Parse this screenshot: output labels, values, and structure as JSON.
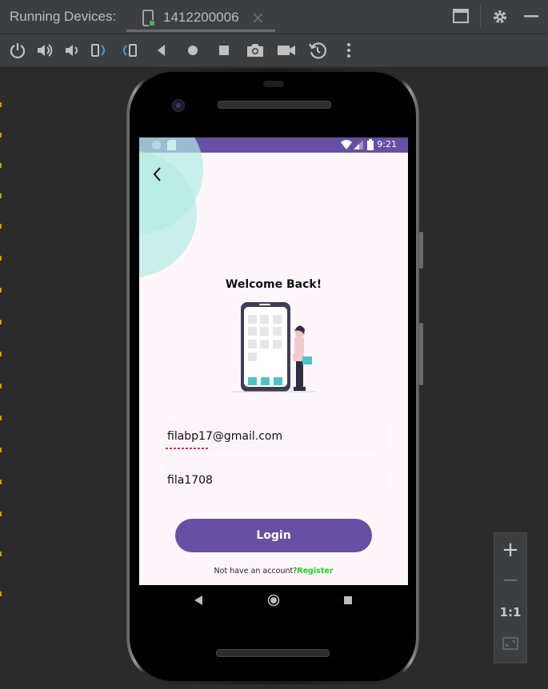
{
  "window": {
    "title": "Running Devices:",
    "tab_label": "1412200006",
    "tab_close": "×"
  },
  "toolbar": {
    "icons": [
      "power-icon",
      "volume-up-icon",
      "volume-down-icon",
      "rotate-left-icon",
      "rotate-right-icon",
      "back-icon",
      "home-icon",
      "overview-icon",
      "screenshot-icon",
      "screen-record-icon",
      "snapshot-icon",
      "more-icon"
    ]
  },
  "device": {
    "status_time": "9:21",
    "welcome_title": "Welcome Back!",
    "email_value": "filabp17@gmail.com",
    "password_value": "fila1708",
    "login_label": "Login",
    "register_prompt": "Not have an account?",
    "register_link": "Register"
  },
  "zoom": {
    "plus": "+",
    "minus": "−",
    "one_to_one": "1:1"
  },
  "colors": {
    "primary": "#6750a4",
    "accent_circle": "#b2ebe2",
    "register_green": "#24d024",
    "ide_bg": "#2b2b2b",
    "ide_panel": "#3c3f41"
  }
}
